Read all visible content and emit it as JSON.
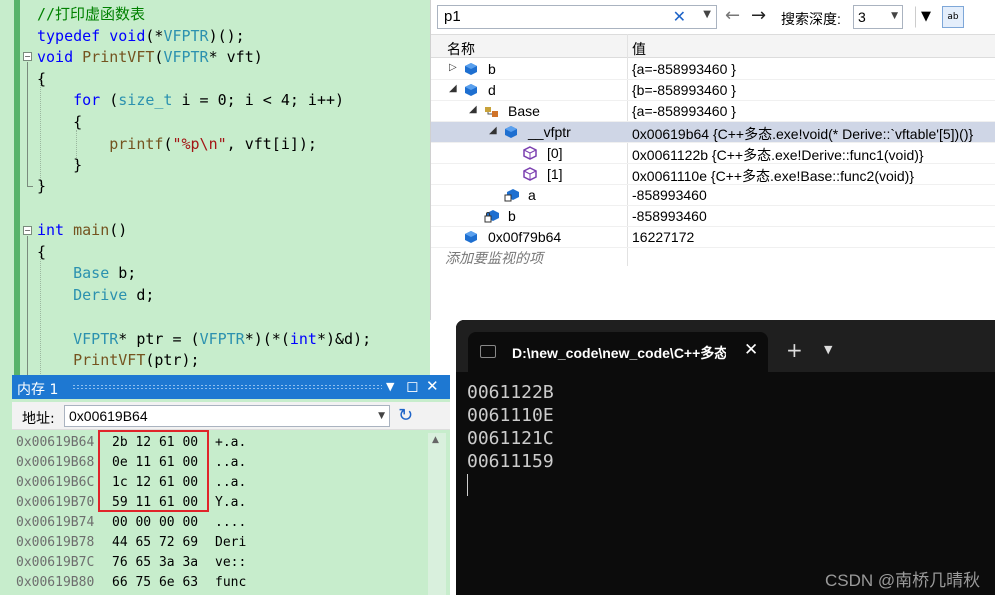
{
  "code": {
    "lines": [
      {
        "segs": [
          {
            "t": "//打印虚函数表",
            "c": "c-cmt"
          }
        ]
      },
      {
        "segs": [
          {
            "t": "typedef ",
            "c": "c-kw"
          },
          {
            "t": "void",
            "c": "c-kw"
          },
          {
            "t": "(*",
            "c": ""
          },
          {
            "t": "VFPTR",
            "c": "c-ty"
          },
          {
            "t": ")();",
            "c": ""
          }
        ]
      },
      {
        "segs": [
          {
            "t": "void ",
            "c": "c-kw"
          },
          {
            "t": "PrintVFT",
            "c": "c-fn"
          },
          {
            "t": "(",
            "c": ""
          },
          {
            "t": "VFPTR",
            "c": "c-ty"
          },
          {
            "t": "* vft)",
            "c": ""
          }
        ]
      },
      {
        "segs": [
          {
            "t": "{",
            "c": ""
          }
        ]
      },
      {
        "segs": [
          {
            "t": "    for ",
            "c": "c-kw"
          },
          {
            "t": "(",
            "c": ""
          },
          {
            "t": "size_t",
            "c": "c-ty"
          },
          {
            "t": " i = 0; i < 4; i++)",
            "c": ""
          }
        ]
      },
      {
        "segs": [
          {
            "t": "    {",
            "c": ""
          }
        ]
      },
      {
        "segs": [
          {
            "t": "        printf",
            "c": "c-fn"
          },
          {
            "t": "(",
            "c": ""
          },
          {
            "t": "\"%p\\n\"",
            "c": "c-str"
          },
          {
            "t": ", vft[i]);",
            "c": ""
          }
        ]
      },
      {
        "segs": [
          {
            "t": "    }",
            "c": ""
          }
        ]
      },
      {
        "segs": [
          {
            "t": "}",
            "c": ""
          }
        ]
      },
      {
        "segs": [
          {
            "t": "",
            "c": ""
          }
        ]
      },
      {
        "segs": [
          {
            "t": "int ",
            "c": "c-kw"
          },
          {
            "t": "main",
            "c": "c-fn"
          },
          {
            "t": "()",
            "c": ""
          }
        ]
      },
      {
        "segs": [
          {
            "t": "{",
            "c": ""
          }
        ]
      },
      {
        "segs": [
          {
            "t": "    Base",
            "c": "c-ty"
          },
          {
            "t": " b;",
            "c": ""
          }
        ]
      },
      {
        "segs": [
          {
            "t": "    Derive",
            "c": "c-ty"
          },
          {
            "t": " d;",
            "c": ""
          }
        ]
      },
      {
        "segs": [
          {
            "t": "",
            "c": ""
          }
        ]
      },
      {
        "segs": [
          {
            "t": "    VFPTR",
            "c": "c-ty"
          },
          {
            "t": "* ptr = (",
            "c": ""
          },
          {
            "t": "VFPTR",
            "c": "c-ty"
          },
          {
            "t": "*)(*(",
            "c": ""
          },
          {
            "t": "int",
            "c": "c-kw"
          },
          {
            "t": "*)&d);",
            "c": ""
          }
        ]
      },
      {
        "segs": [
          {
            "t": "    PrintVFT",
            "c": "c-fn"
          },
          {
            "t": "(ptr);",
            "c": ""
          }
        ]
      }
    ]
  },
  "watch": {
    "search": "p1",
    "clear_icon": "✕",
    "depth_label": "搜索深度:",
    "depth_value": "3",
    "col_name": "名称",
    "col_value": "值",
    "rows": [
      {
        "name": "b",
        "value": "{a=-858993460 }",
        "exp": "▷",
        "icon": "object",
        "indent": 0
      },
      {
        "name": "d",
        "value": "{b=-858993460 }",
        "exp": "◢",
        "icon": "object",
        "indent": 0
      },
      {
        "name": "Base",
        "value": "{a=-858993460 }",
        "exp": "◢",
        "icon": "base-class",
        "indent": 1
      },
      {
        "name": "__vfptr",
        "value": "0x00619b64 {C++多态.exe!void(* Derive::`vftable'[5])()}",
        "exp": "◢",
        "icon": "object",
        "indent": 2,
        "sel": true
      },
      {
        "name": "[0]",
        "value": "0x0061122b {C++多态.exe!Derive::func1(void)}",
        "exp": "",
        "icon": "method",
        "indent": 3
      },
      {
        "name": "[1]",
        "value": "0x0061110e {C++多态.exe!Base::func2(void)}",
        "exp": "",
        "icon": "method",
        "indent": 3
      },
      {
        "name": "a",
        "value": "-858993460",
        "exp": "",
        "icon": "protected-field",
        "indent": 2
      },
      {
        "name": "b",
        "value": "-858993460",
        "exp": "",
        "icon": "private-field",
        "indent": 1
      },
      {
        "name": "0x00f79b64",
        "value": "16227172",
        "exp": "",
        "icon": "object",
        "indent": 0
      }
    ],
    "add_hint": "添加要监视的项"
  },
  "memory": {
    "title": "内存 1",
    "addr_label": "地址:",
    "addr_value": "0x00619B64",
    "rows": [
      {
        "a": "0x00619B64",
        "h": "2b 12 61 00",
        "s": "+.a."
      },
      {
        "a": "0x00619B68",
        "h": "0e 11 61 00",
        "s": "..a."
      },
      {
        "a": "0x00619B6C",
        "h": "1c 12 61 00",
        "s": "..a."
      },
      {
        "a": "0x00619B70",
        "h": "59 11 61 00",
        "s": "Y.a."
      },
      {
        "a": "0x00619B74",
        "h": "00 00 00 00",
        "s": "...."
      },
      {
        "a": "0x00619B78",
        "h": "44 65 72 69",
        "s": "Deri"
      },
      {
        "a": "0x00619B7C",
        "h": "76 65 3a 3a",
        "s": "ve::"
      },
      {
        "a": "0x00619B80",
        "h": "66 75 6e 63",
        "s": "func"
      }
    ]
  },
  "terminal": {
    "tab_title": "D:\\new_code\\new_code\\C++多态",
    "output": [
      "0061122B",
      "0061110E",
      "0061121C",
      "00611159"
    ]
  },
  "watermark": "CSDN @南桥几晴秋"
}
